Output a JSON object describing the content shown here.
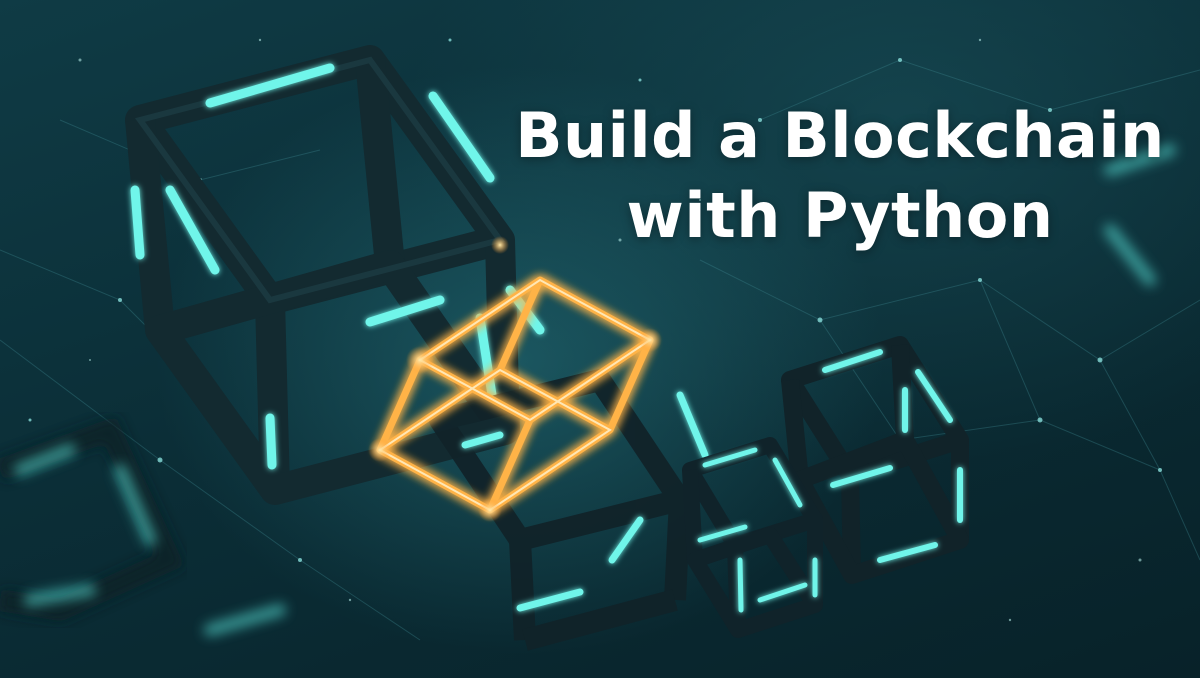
{
  "hero": {
    "title_line_1": "Build a Blockchain",
    "title_line_2": "with Python"
  },
  "colors": {
    "background": "#0b2e37",
    "cube_glow_cyan": "#5ef2e6",
    "cube_glow_orange": "#ffb347",
    "title_text": "#ffffff"
  },
  "icons": [
    "wireframe-cube-icon",
    "network-node-icon"
  ]
}
